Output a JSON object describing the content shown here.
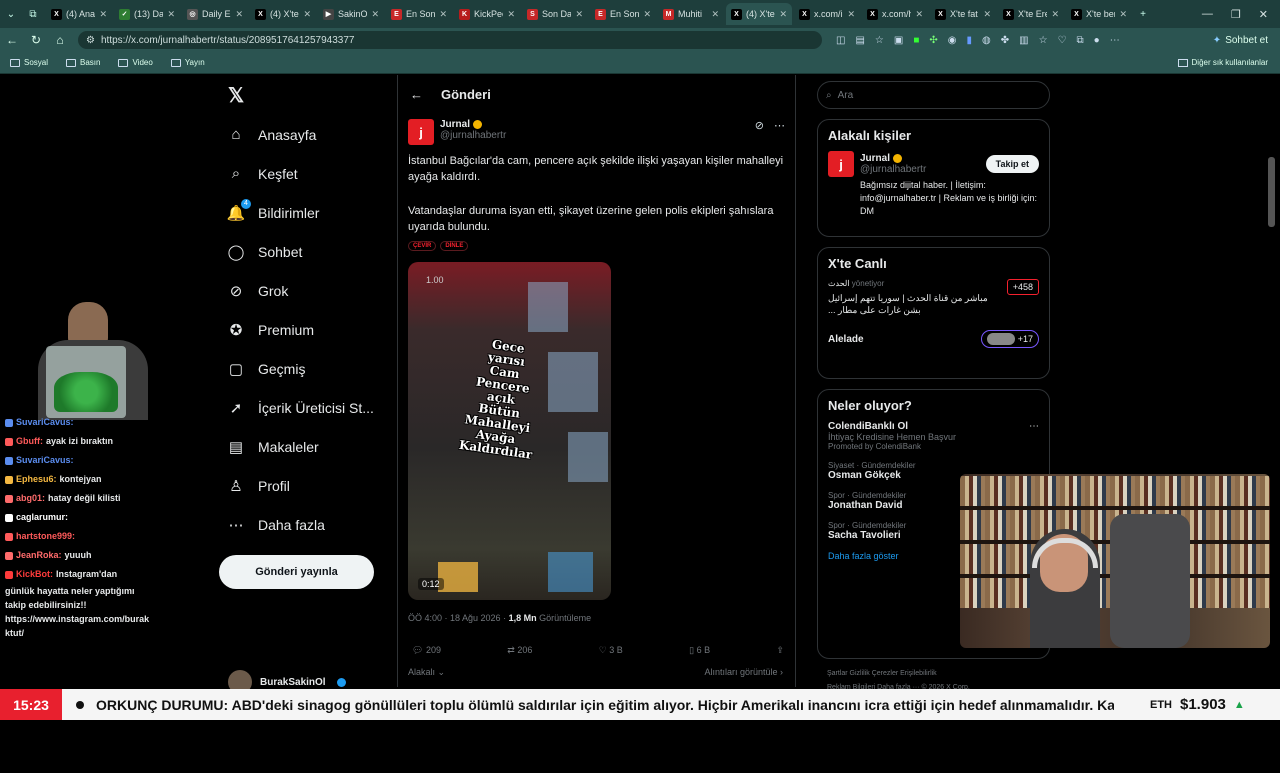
{
  "tabs": [
    {
      "title": "(4) Ana",
      "fav": "X",
      "color": "#000"
    },
    {
      "title": "(13) Da",
      "fav": "✓",
      "color": "#2e7d32"
    },
    {
      "title": "Daily En",
      "fav": "◎",
      "color": "#555"
    },
    {
      "title": "(4) X'te",
      "fav": "X",
      "color": "#000"
    },
    {
      "title": "SakinOl",
      "fav": "▶",
      "color": "#444"
    },
    {
      "title": "En Son",
      "fav": "E",
      "color": "#c62828"
    },
    {
      "title": "KickPee",
      "fav": "K",
      "color": "#b71c1c"
    },
    {
      "title": "Son Da",
      "fav": "S",
      "color": "#c62828"
    },
    {
      "title": "En Son",
      "fav": "E",
      "color": "#c62828"
    },
    {
      "title": "Muhiti",
      "fav": "M",
      "color": "#c62828"
    },
    {
      "title": "(4) X'te",
      "fav": "X",
      "color": "#000",
      "active": true
    },
    {
      "title": "x.com/i",
      "fav": "X",
      "color": "#000"
    },
    {
      "title": "x.com/h",
      "fav": "X",
      "color": "#000"
    },
    {
      "title": "X'te fat",
      "fav": "X",
      "color": "#000"
    },
    {
      "title": "X'te Ere",
      "fav": "X",
      "color": "#000"
    },
    {
      "title": "X'te ber",
      "fav": "X",
      "color": "#000"
    }
  ],
  "browser": {
    "url": "https://x.com/jurnalhabertr/status/2089517641257943377",
    "sohbet": "Sohbet et"
  },
  "bookmarks": [
    "Sosyal",
    "Basın",
    "Video",
    "Yayın"
  ],
  "bookmarks_other": "Diğer sık kullanılanlar",
  "nav": [
    {
      "label": "Anasayfa",
      "icon": "⌂"
    },
    {
      "label": "Keşfet",
      "icon": "⌕"
    },
    {
      "label": "Bildirimler",
      "icon": "🔔"
    },
    {
      "label": "Sohbet",
      "icon": "◯"
    },
    {
      "label": "Grok",
      "icon": "⊘"
    },
    {
      "label": "Premium",
      "icon": "✪"
    },
    {
      "label": "Geçmiş",
      "icon": "▢"
    },
    {
      "label": "İçerik Üreticisi St...",
      "icon": "➚"
    },
    {
      "label": "Makaleler",
      "icon": "▤"
    },
    {
      "label": "Profil",
      "icon": "♙"
    },
    {
      "label": "Daha fazla",
      "icon": "⋯"
    }
  ],
  "notif_badge": "4",
  "post_button": "Gönderi yayınla",
  "current_user": "BurakSakinOl",
  "post": {
    "header": "Gönderi",
    "author": "Jurnal",
    "handle": "@jurnalhabertr",
    "text1": "İstanbul Bağcılar'da cam, pencere açık şekilde ilişki yaşayan kişiler mahalleyi ayağa kaldırdı.",
    "text2": "Vatandaşlar duruma isyan etti, şikayet üzerine gelen polis ekipleri şahıslara uyarıda bulundu.",
    "tag1": "ÇEVİR",
    "tag2": "DİNLE",
    "video_caption": "Gece yarısı Cam Pencere açık Bütün Mahalleyi Ayağa Kaldırdılar",
    "video_speed": "1.00",
    "video_duration": "0:12",
    "time": "ÖÖ 4:00 · 18 Ağu 2026 · ",
    "views": "1,8 Mn",
    "views_label": " Görüntüleme",
    "replies": "209",
    "reposts": "206",
    "likes": "3 B",
    "bookmarks": "6 B",
    "relevant": "Alakalı",
    "quotes": "Alıntıları görüntüle"
  },
  "right": {
    "search_placeholder": "Ara",
    "people_title": "Alakalı kişiler",
    "person_name": "Jurnal",
    "person_handle": "@jurnalhabertr",
    "follow": "Takip et",
    "bio": "Bağımsız dijital haber. | İletişim: info@jurnalhaber.tr | Reklam ve iş birliği için: DM",
    "live_title": "X'te Canlı",
    "live_host": "الحدث",
    "live_role": "yönetiyor",
    "live_text": "مباشر من قناة الحدث | سوريا تتهم إسرائيل بشن غارات على مطار ...",
    "live_count": "+458",
    "alelade": "Alelade",
    "alelade_count": "+17",
    "trends_title": "Neler oluyor?",
    "ad_name": "ColendiBanklı Ol",
    "ad_sub": "İhtiyaç Kredisine Hemen Başvur",
    "ad_promo": "Promoted by ColendiBank",
    "trends": [
      {
        "cat": "Siyaset · Gündemdekiler",
        "name": "Osman Gökçek"
      },
      {
        "cat": "Spor · Gündemdekiler",
        "name": "Jonathan David"
      },
      {
        "cat": "Spor · Gündemdekiler",
        "name": "Sacha Tavolieri"
      }
    ],
    "more": "Daha fazla göster",
    "footer1": "Şartlar   Gizlilik   Çerezler   Erişilebilirlik",
    "footer2": "Reklam Bilgileri   Daha fazla ···   © 2026 X Corp."
  },
  "chat": [
    {
      "user": "SuvariCavus:",
      "msg": "",
      "color": "#5b8def"
    },
    {
      "user": "Gbuff:",
      "msg": "ayak izi bıraktın",
      "color": "#ff5a5a"
    },
    {
      "user": "SuvariCavus:",
      "msg": "",
      "color": "#5b8def"
    },
    {
      "user": "Ephesu6:",
      "msg": "kontejyan",
      "color": "#f5b942"
    },
    {
      "user": "abg01:",
      "msg": "hatay değil kilisti",
      "color": "#ff6b6b"
    },
    {
      "user": "caglarumur:",
      "msg": "",
      "color": "#ffffff"
    },
    {
      "user": "hartstone999:",
      "msg": "",
      "color": "#ff5a5a"
    },
    {
      "user": "JeanRoka:",
      "msg": "yuuuh",
      "color": "#ff6b6b"
    },
    {
      "user": "KickBot:",
      "msg": "Instagram'dan",
      "color": "#ff3b3b"
    }
  ],
  "kickbot_rest": [
    "günlük hayatta neler yaptığımı",
    "takip edebilirsiniz!!",
    "https://www.instagram.com/burak",
    "ktut/"
  ],
  "ticker": {
    "time": "15:23",
    "news": "ORKUNÇ DURUMU: ABD'deki sinagog gönüllüleri toplu ölümlü saldırılar için eğitim alıyor. Hiçbir Amerikalı inancını icra ettiği için hedef alınmamalıdır. Kamu g",
    "eth_label": "ETH",
    "eth_price": "$1.903",
    "eth_trend": "▲"
  }
}
